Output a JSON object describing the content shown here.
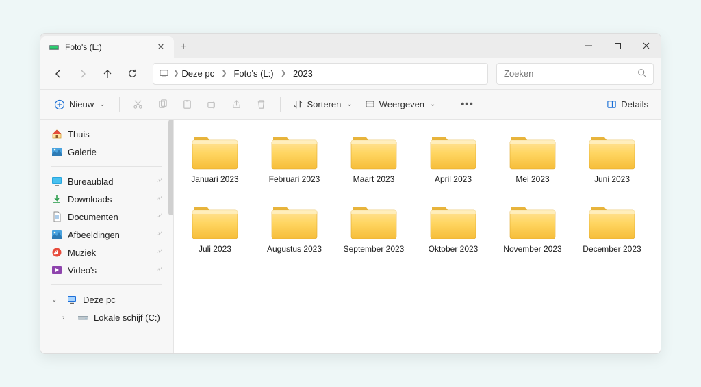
{
  "tab_title": "Foto's (L:)",
  "breadcrumbs": [
    "Deze pc",
    "Foto's (L:)",
    "2023"
  ],
  "search": {
    "placeholder": "Zoeken"
  },
  "toolbar": {
    "new": "Nieuw",
    "sort": "Sorteren",
    "view": "Weergeven",
    "details": "Details"
  },
  "sidebar": {
    "home": "Thuis",
    "gallery": "Galerie",
    "quick": [
      {
        "label": "Bureaublad"
      },
      {
        "label": "Downloads"
      },
      {
        "label": "Documenten"
      },
      {
        "label": "Afbeeldingen"
      },
      {
        "label": "Muziek"
      },
      {
        "label": "Video's"
      }
    ],
    "thispc": "Deze pc",
    "drive_c": "Lokale schijf (C:)"
  },
  "folders": [
    "Januari 2023",
    "Februari 2023",
    "Maart 2023",
    "April 2023",
    "Mei 2023",
    "Juni 2023",
    "Juli 2023",
    "Augustus 2023",
    "September 2023",
    "Oktober 2023",
    "November 2023",
    "December 2023"
  ]
}
